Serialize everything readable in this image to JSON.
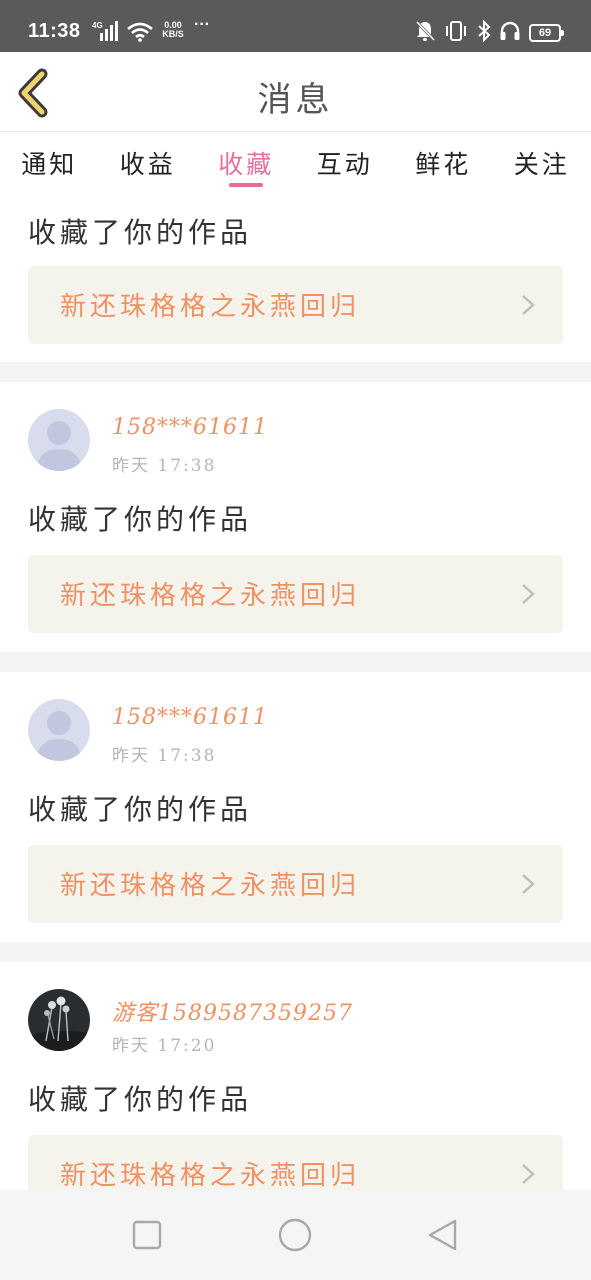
{
  "status_bar": {
    "time": "11:38",
    "network": "4G",
    "speed_value": "0.00",
    "speed_unit": "KB/S",
    "more": "···",
    "battery": "69"
  },
  "header": {
    "title": "消息",
    "back_icon": "chevron-left-icon"
  },
  "tabs": [
    {
      "label": "通知",
      "active": false
    },
    {
      "label": "收益",
      "active": false
    },
    {
      "label": "收藏",
      "active": true
    },
    {
      "label": "互动",
      "active": false
    },
    {
      "label": "鲜花",
      "active": false
    },
    {
      "label": "关注",
      "active": false
    }
  ],
  "colors": {
    "accent": "#e46d9c",
    "orange_text": "#ef9163",
    "card_bg": "#f4f3ec",
    "status_bar_bg": "#5a5a5a"
  },
  "messages": [
    {
      "action": "收藏了你的作品",
      "work_title": "新还珠格格之永燕回归"
    },
    {
      "username": "158***61611",
      "time": "昨天 17:38",
      "action": "收藏了你的作品",
      "work_title": "新还珠格格之永燕回归",
      "avatar": "default-avatar"
    },
    {
      "username": "158***61611",
      "time": "昨天 17:38",
      "action": "收藏了你的作品",
      "work_title": "新还珠格格之永燕回归",
      "avatar": "default-avatar"
    },
    {
      "username": "游客1589587359257",
      "time": "昨天 17:20",
      "action": "收藏了你的作品",
      "work_title": "新还珠格格之永燕回归",
      "avatar": "photo-avatar"
    }
  ],
  "navbar": {
    "recents_icon": "square-icon",
    "home_icon": "circle-icon",
    "back_icon": "triangle-back-icon"
  }
}
